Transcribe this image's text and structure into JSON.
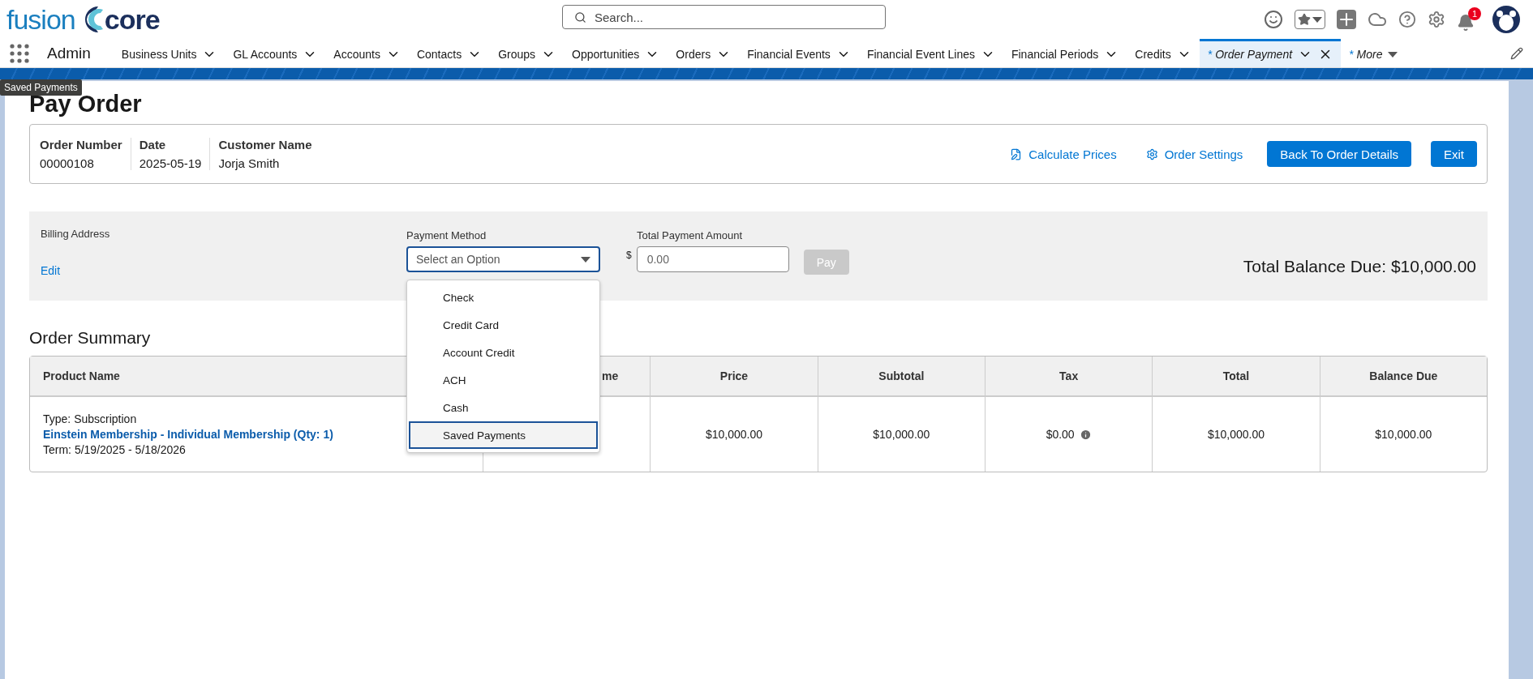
{
  "header": {
    "logo": {
      "left": "fusion",
      "right": "core"
    },
    "search": {
      "placeholder": "Search..."
    },
    "notifications": {
      "badge": "1"
    }
  },
  "nav": {
    "app": "Admin",
    "tabs": [
      {
        "label": "Business Units",
        "selected": false,
        "kind": "menu"
      },
      {
        "label": "GL Accounts",
        "selected": false,
        "kind": "menu"
      },
      {
        "label": "Accounts",
        "selected": false,
        "kind": "menu"
      },
      {
        "label": "Contacts",
        "selected": false,
        "kind": "menu"
      },
      {
        "label": "Groups",
        "selected": false,
        "kind": "menu"
      },
      {
        "label": "Opportunities",
        "selected": false,
        "kind": "menu"
      },
      {
        "label": "Orders",
        "selected": false,
        "kind": "menu"
      },
      {
        "label": "Financial Events",
        "selected": false,
        "kind": "menu"
      },
      {
        "label": "Financial Event Lines",
        "selected": false,
        "kind": "menu"
      },
      {
        "label": "Financial Periods",
        "selected": false,
        "kind": "menu"
      },
      {
        "label": "Credits",
        "selected": false,
        "kind": "menu"
      },
      {
        "label": "Order Payment",
        "marker": "*",
        "selected": true,
        "kind": "open"
      },
      {
        "label": "More",
        "marker": "*",
        "selected": false,
        "kind": "more"
      }
    ]
  },
  "tooltip": "Saved Payments",
  "page": {
    "title": "Pay Order",
    "fields": [
      {
        "label": "Order Number",
        "value": "00000108"
      },
      {
        "label": "Date",
        "value": "2025-05-19"
      },
      {
        "label": "Customer Name",
        "value": "Jorja Smith"
      }
    ],
    "actions": [
      {
        "label": "Calculate Prices",
        "kind": "calculate"
      },
      {
        "label": "Order Settings",
        "kind": "settings"
      },
      {
        "label": "Back To Order Details",
        "kind": "button"
      },
      {
        "label": "Exit",
        "kind": "button"
      }
    ]
  },
  "billing": {
    "label": "Billing Address",
    "edit": "Edit"
  },
  "payment": {
    "label": "Payment Method",
    "placeholder": "Select an Option",
    "expanded": true,
    "options": [
      {
        "label": "Check",
        "selected": false
      },
      {
        "label": "Credit Card",
        "selected": false
      },
      {
        "label": "Account Credit",
        "selected": false
      },
      {
        "label": "ACH",
        "selected": false
      },
      {
        "label": "Cash",
        "selected": false
      },
      {
        "label": "Saved Payments",
        "selected": true
      }
    ]
  },
  "amount": {
    "label": "Total Payment Amount",
    "currency": "$",
    "placeholder": "0.00"
  },
  "pay": {
    "label": "Pay",
    "disabled": true
  },
  "balance": "Total Balance Due: $10,000.00",
  "summary": {
    "title": "Order Summary",
    "columns": [
      "Product Name",
      "me",
      "Price",
      "Subtotal",
      "Tax",
      "Total",
      "Balance Due"
    ],
    "rows": [
      {
        "type": "Type: Subscription",
        "product": "Einstein Membership - Individual Membership (Qty: 1)",
        "term": "Term: 5/19/2025 - 5/18/2026",
        "price": "$10,000.00",
        "subtotal": "$10,000.00",
        "tax": "$0.00",
        "total": "$10,000.00",
        "balance_due": "$10,000.00"
      }
    ]
  }
}
